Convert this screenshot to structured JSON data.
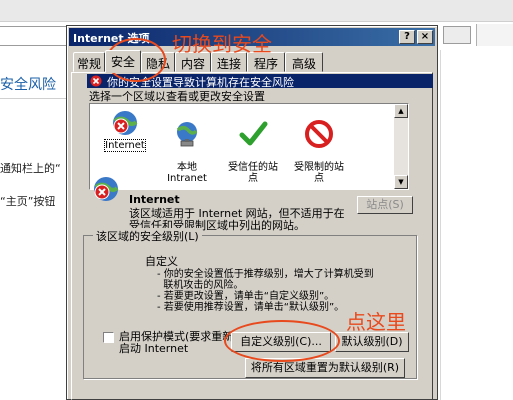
{
  "background": {
    "heading": "安全风险",
    "line1": "通知栏上的“",
    "line2": "“主页”按钮"
  },
  "dialog": {
    "title": "Internet 选项",
    "help_button": "?",
    "close_button": "×",
    "tabs": [
      {
        "label": "常规"
      },
      {
        "label": "安全"
      },
      {
        "label": "隐私"
      },
      {
        "label": "内容"
      },
      {
        "label": "连接"
      },
      {
        "label": "程序"
      },
      {
        "label": "高级"
      }
    ],
    "warning_bar": "你的安全设置导致计算机存在安全风险",
    "zone_hint": "选择一个区域以查看或更改安全设置",
    "zones": [
      {
        "label": "Internet",
        "icon": "internet-warning-icon"
      },
      {
        "label": "本地\nIntranet",
        "icon": "intranet-globe-icon"
      },
      {
        "label": "受信任的站\n点",
        "icon": "trusted-check-icon"
      },
      {
        "label": "受限制的站\n点",
        "icon": "restricted-no-icon"
      }
    ],
    "zone_info": {
      "title": "Internet",
      "description": "该区域适用于 Internet 网站，但不适用于在受信任和受限制区域中列出的网站。"
    },
    "sites_button": "站点(S)",
    "security_level": {
      "legend": "该区域的安全级别(L)",
      "title": "自定义",
      "bullets": [
        "- 你的安全设置低于推荐级别，增大了计算机受到",
        "  联机攻击的风险。",
        "- 若要更改设置，请单击“自定义级别”。",
        "- 若要使用推荐设置，请单击“默认级别”。"
      ]
    },
    "protected_mode": "启用保护模式(要求重新启动 Internet",
    "custom_level_button": "自定义级别(C)...",
    "default_level_button": "默认级别(D)",
    "reset_all_button": "将所有区域重置为默认级别(R)"
  },
  "annotations": {
    "switch_label": "切换到安全",
    "click_label": "点这里",
    "color": "#e8491d"
  },
  "colors": {
    "titlebar": "#0a246a",
    "dialog_face": "#d4d0c8",
    "link_blue": "#1a5fa8"
  }
}
